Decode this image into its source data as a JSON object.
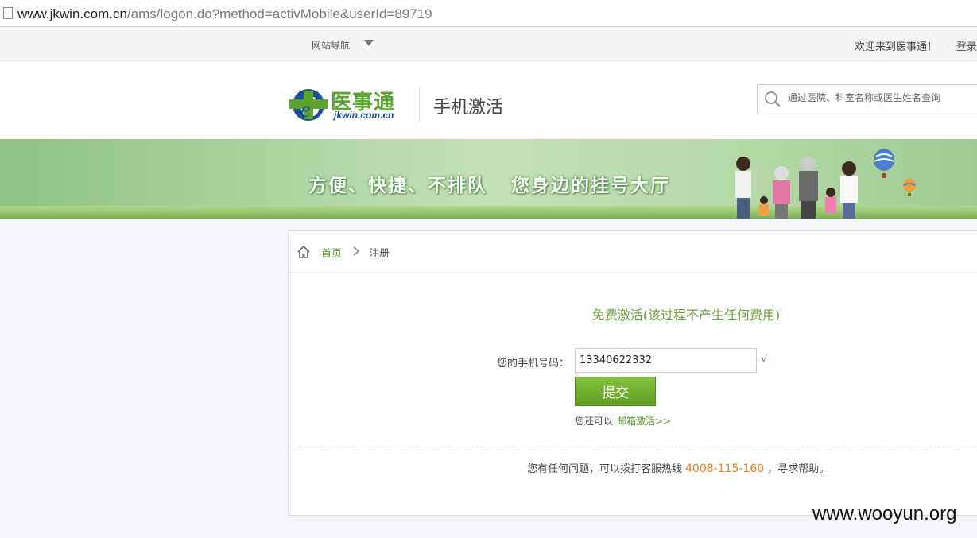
{
  "browser": {
    "url_domain": "www.jkwin.com.cn",
    "url_path": "/ams/logon.do?method=activMobile&userId=89719"
  },
  "topnav": {
    "site_nav": "网站导航",
    "welcome": "欢迎来到医事通！",
    "login": "登录"
  },
  "header": {
    "logo_text": "医事通",
    "logo_sub": "jkwin.com.cn",
    "page_title": "手机激活",
    "search_placeholder": "通过医院、科室名称或医生姓名查询"
  },
  "banner": {
    "slogan_left": "方便、快捷、不排队",
    "slogan_right": "您身边的挂号大厅"
  },
  "breadcrumb": {
    "home": "首页",
    "current": "注册"
  },
  "form": {
    "title": "免费激活(该过程不产生任何费用)",
    "phone_label": "您的手机号码：",
    "phone_value": "13340622332",
    "valid_mark": "√",
    "submit_label": "提交",
    "alt_prefix": "您还可以",
    "alt_link": "邮箱激活>>"
  },
  "footer": {
    "help_prefix": "您有任何问题，可以拨打客服热线",
    "hotline": "4008-115-160",
    "help_suffix": "，寻求帮助。"
  },
  "watermark": "www.wooyun.org",
  "colors": {
    "brand_green": "#5ba52f",
    "link_green": "#5a9a2a",
    "hotline_orange": "#e87d1a"
  }
}
